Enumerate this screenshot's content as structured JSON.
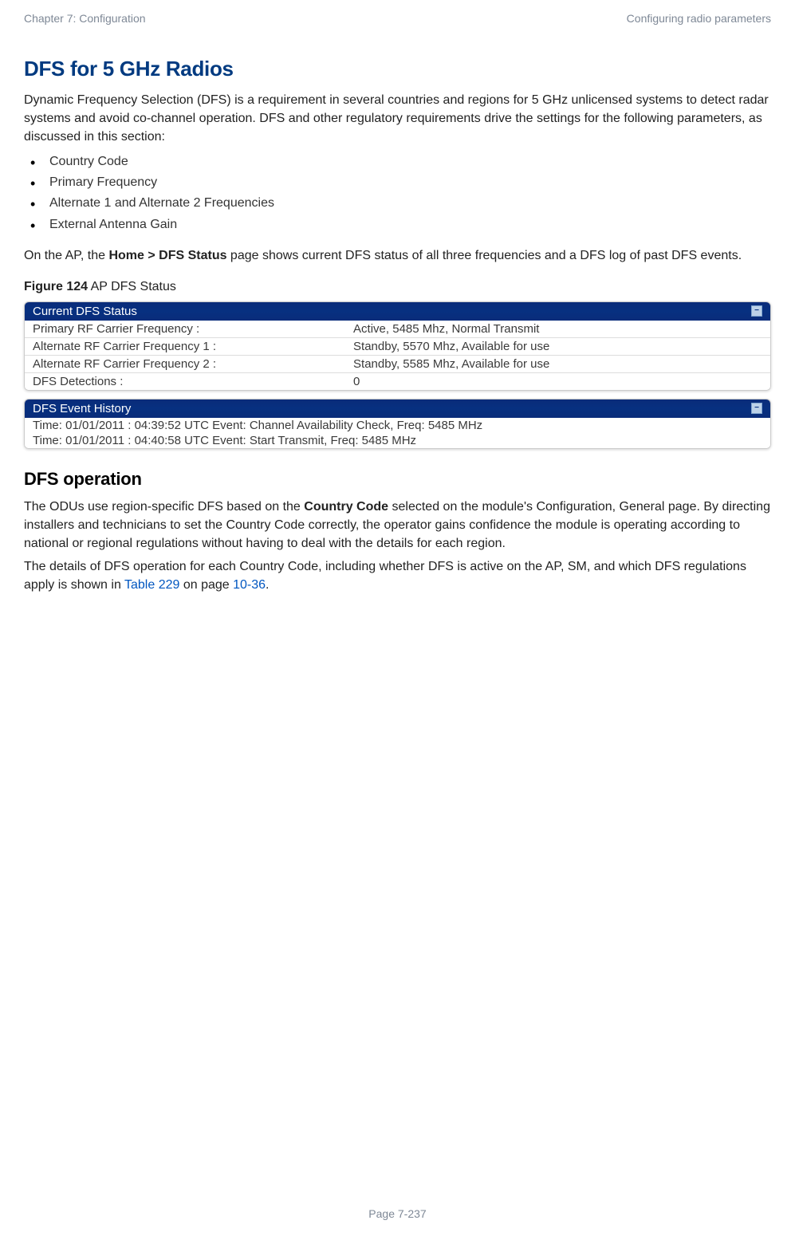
{
  "header": {
    "left": "Chapter 7:  Configuration",
    "right": "Configuring radio parameters"
  },
  "h1": "DFS for 5 GHz Radios",
  "intro": "Dynamic Frequency Selection (DFS) is a requirement in several countries and regions for 5 GHz unlicensed systems to detect radar systems and avoid co-channel operation. DFS and other regulatory requirements drive the settings for the following parameters, as discussed in this section:",
  "bullets": [
    "Country Code",
    "Primary Frequency",
    "Alternate 1 and Alternate 2 Frequencies",
    "External Antenna Gain"
  ],
  "ap_para_pre": "On the AP, the ",
  "ap_para_bold": "Home > DFS Status",
  "ap_para_post": " page shows current DFS status of all three frequencies and a DFS log of past DFS events.",
  "figure_label_bold": "Figure 124",
  "figure_label_rest": "  AP DFS Status",
  "panel1": {
    "title": "Current DFS Status",
    "rows": [
      {
        "label": "Primary RF Carrier Frequency :",
        "value": "Active, 5485 Mhz, Normal Transmit"
      },
      {
        "label": "Alternate RF Carrier Frequency 1 :",
        "value": "Standby, 5570 Mhz, Available for use"
      },
      {
        "label": "Alternate RF Carrier Frequency 2 :",
        "value": "Standby, 5585 Mhz, Available for use"
      },
      {
        "label": "DFS Detections :",
        "value": "0"
      }
    ]
  },
  "panel2": {
    "title": "DFS Event History",
    "lines": [
      "Time: 01/01/2011 : 04:39:52 UTC Event: Channel Availability Check, Freq: 5485 MHz",
      "Time: 01/01/2011 : 04:40:58 UTC Event: Start Transmit, Freq: 5485 MHz"
    ]
  },
  "h2": "DFS operation",
  "op_para1_pre": "The ODUs use region-specific DFS based on the ",
  "op_para1_bold": "Country Code",
  "op_para1_post": " selected on the module's Configuration, General page.  By directing installers and technicians to set the Country Code correctly, the operator gains confidence the module is operating according to national or regional regulations without having to deal with the details for each region.",
  "op_para2_pre": "The details of DFS operation for each Country Code, including whether DFS is active on the AP, SM, and which DFS regulations apply is shown in ",
  "op_para2_link1": "Table 229",
  "op_para2_mid": " on page ",
  "op_para2_link2": "10-36",
  "op_para2_post": ".",
  "footer": "Page 7-237"
}
